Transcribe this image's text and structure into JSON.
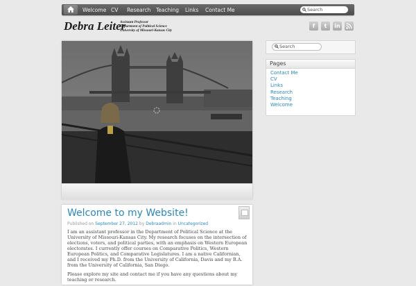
{
  "nav": {
    "items": [
      "Welcome",
      "CV",
      "Research",
      "Teaching",
      "Links",
      "Contact Me"
    ],
    "search_placeholder": "Search"
  },
  "header": {
    "title": "Debra Leiter",
    "tagline_1": "Assistant Professor",
    "tagline_2": "Department of Political Science",
    "tagline_3": "University of Missouri-Kansas City",
    "social": [
      "facebook-icon",
      "twitter-icon",
      "linkedin-icon",
      "rss-icon"
    ]
  },
  "sidebar": {
    "search_placeholder": "Search",
    "pages_title": "Pages",
    "pages": [
      "Contact Me",
      "CV",
      "Links",
      "Research",
      "Teaching",
      "Welcome"
    ]
  },
  "post": {
    "title": "Welcome to my Website!",
    "meta_published": "Published on",
    "meta_date": "September 27, 2012",
    "meta_by": "by",
    "meta_author": "Debraadmin",
    "meta_in": "in",
    "meta_category": "Uncategorized",
    "paragraph_1": "I am an assistant professor in the Department of Political Science at the University of Missouri-Kansas City.  My research focuses on the intersection of elections, voters, and political parties, with an emphasis on Western European electorates.  I currently offer courses on Comparative Politics, Western European Politics, and Comparative Legislatures.  I am a native Californian, and I received my Ph.D. from the University of California, Davis and my B.A. from the University of California, San Diego.",
    "paragraph_2": "Please explore my site and contact me if you have any questions about my teaching or research."
  },
  "colors": {
    "link": "#2a88b9",
    "nav_bg": "#555555",
    "page_bg": "#e9e9e9"
  }
}
